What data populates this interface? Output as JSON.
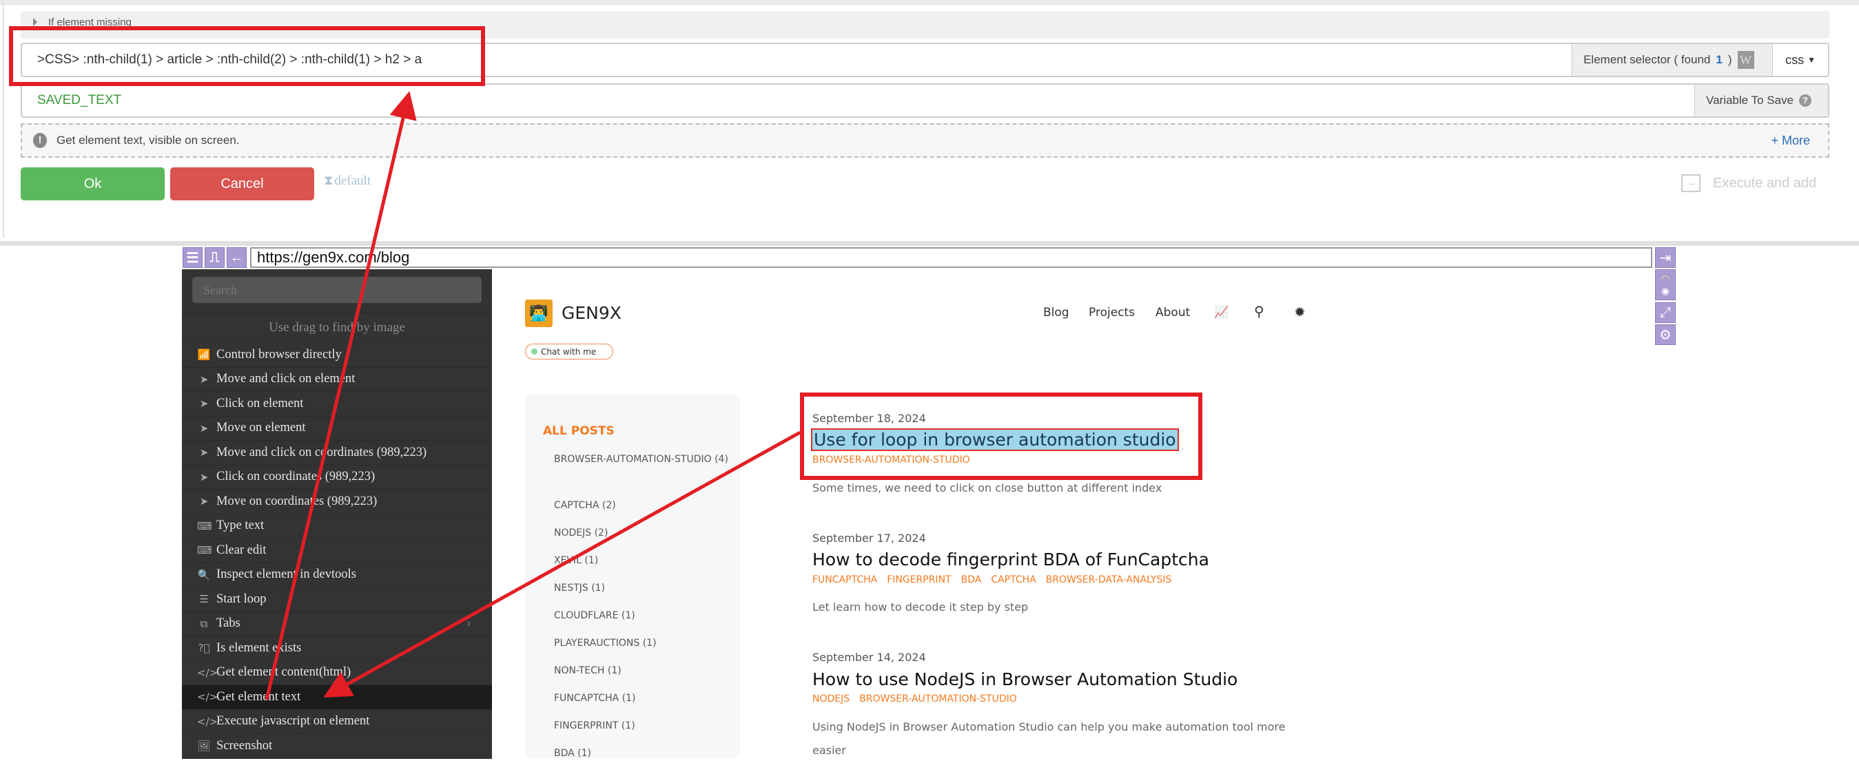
{
  "action_panel": {
    "if_element_missing": "If element missing",
    "selector_value": ">CSS> :nth-child(1) > article > :nth-child(2) > :nth-child(1) > h2 > a",
    "selector_label_prefix": "Element selector ( found",
    "selector_found_count": "1",
    "selector_label_suffix": ")",
    "selector_type": "css",
    "variable_value": "SAVED_TEXT",
    "variable_label": "Variable To Save",
    "info_text": "Get element text, visible on screen.",
    "more_link": "+ More",
    "ok_label": "Ok",
    "cancel_label": "Cancel",
    "default_label": "default",
    "execute_add_label": "Execute and add"
  },
  "browser": {
    "url": "https://gen9x.com/blog"
  },
  "context_menu": {
    "search_placeholder": "Search",
    "drag_hint": "Use drag to find by image",
    "items": [
      {
        "icon": "wifi-icon",
        "label": "Control browser directly"
      },
      {
        "icon": "cursor-icon",
        "label": "Move and click on element"
      },
      {
        "icon": "cursor-icon",
        "label": "Click on element"
      },
      {
        "icon": "cursor-icon",
        "label": "Move on element"
      },
      {
        "icon": "cursor-icon",
        "label": "Move and click on coordinates (989,223)"
      },
      {
        "icon": "cursor-icon",
        "label": "Click on coordinates (989,223)"
      },
      {
        "icon": "cursor-icon",
        "label": "Move on coordinates (989,223)"
      },
      {
        "icon": "keyboard-icon",
        "label": "Type text"
      },
      {
        "icon": "keyboard-icon",
        "label": "Clear edit"
      },
      {
        "icon": "search-icon",
        "label": "Inspect element in devtools"
      },
      {
        "icon": "list-icon",
        "label": "Start loop"
      },
      {
        "icon": "tabs-icon",
        "label": "Tabs"
      },
      {
        "icon": "question-icon",
        "label": "Is element exists"
      },
      {
        "icon": "code-icon",
        "label": "Get element content(html)"
      },
      {
        "icon": "code-icon",
        "label": "Get element text"
      },
      {
        "icon": "code-icon",
        "label": "Execute javascript on element"
      },
      {
        "icon": "image-icon",
        "label": "Screenshot"
      }
    ],
    "selected": "Get element text"
  },
  "site": {
    "brand": "GEN9X",
    "nav": [
      "Blog",
      "Projects",
      "About"
    ],
    "chat_button": "Chat with me",
    "categories_title": "ALL POSTS",
    "categories": [
      "BROWSER-AUTOMATION-STUDIO (4)",
      "CAPTCHA (2)",
      "NODEJS (2)",
      "XEVIL (1)",
      "NESTJS (1)",
      "CLOUDFLARE (1)",
      "PLAYERAUCTIONS (1)",
      "NON-TECH (1)",
      "FUNCAPTCHA (1)",
      "FINGERPRINT (1)",
      "BDA (1)"
    ],
    "posts": [
      {
        "date": "September 18, 2024",
        "title": "Use for loop in browser automation studio",
        "tags": [
          "BROWSER-AUTOMATION-STUDIO"
        ],
        "excerpt": "Some times, we need to click on close button at different index"
      },
      {
        "date": "September 17, 2024",
        "title": "How to decode fingerprint BDA of FunCaptcha",
        "tags": [
          "FUNCAPTCHA",
          "FINGERPRINT",
          "BDA",
          "CAPTCHA",
          "BROWSER-DATA-ANALYSIS"
        ],
        "excerpt": "Let learn how to decode it step by step"
      },
      {
        "date": "September 14, 2024",
        "title": "How to use NodeJS in Browser Automation Studio",
        "tags": [
          "NODEJS",
          "BROWSER-AUTOMATION-STUDIO"
        ],
        "excerpt": "Using NodeJS in Browser Automation Studio can help you make automation tool more easier"
      }
    ]
  },
  "colors": {
    "annotation": "#e31e24",
    "accent": "#f47a20",
    "ok": "#5cb85c",
    "cancel": "#d9534f",
    "toolbar": "#a89bd3",
    "highlight": "#9fd6ea"
  }
}
